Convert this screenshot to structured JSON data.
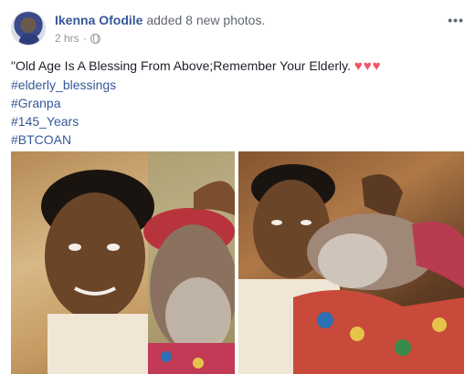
{
  "post": {
    "author": "Ikenna Ofodile",
    "action": "added 8 new photos.",
    "time": "2 hrs",
    "separator": "·",
    "more_label": "•••",
    "privacy_icon": "globe-icon",
    "text": {
      "quote": "\"Old Age Is A Blessing From Above;Remember Your Elderly.",
      "hearts": "♥♥♥",
      "hashtags": [
        "#elderly_blessings",
        "#Granpa",
        "#145_Years",
        "#BTCOAN"
      ]
    }
  },
  "colors": {
    "link": "#365899",
    "meta": "#90949c",
    "heart": "#f25268"
  }
}
